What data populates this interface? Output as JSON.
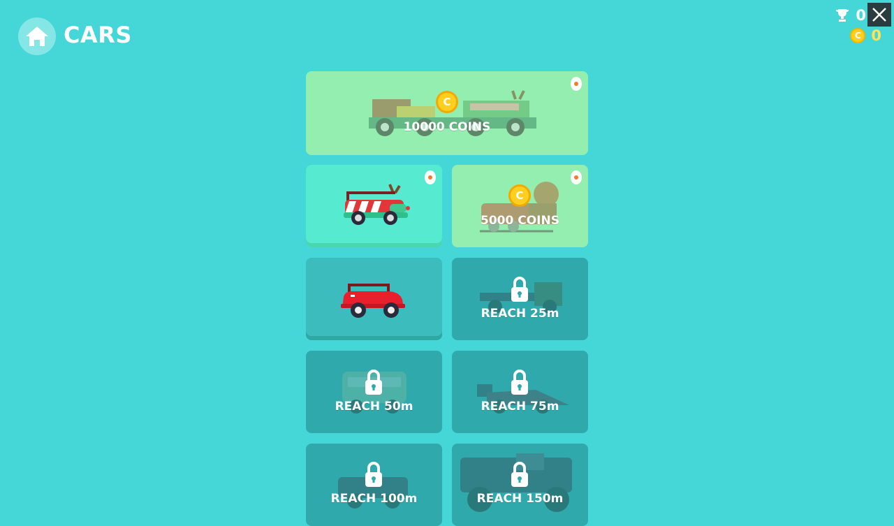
{
  "header": {
    "title": "CARS",
    "trophy_count": "0",
    "coin_count": "0"
  },
  "icons": {
    "home": "home-icon",
    "trophy": "trophy-icon",
    "coin": "coin-icon",
    "close": "close-icon",
    "egg": "egg-icon",
    "lock": "lock-icon"
  },
  "cars": [
    {
      "id": "reindeer-sleigh-limo",
      "state": "for-sale",
      "label": "10000 COINS"
    },
    {
      "id": "reindeer-jeep",
      "state": "selected",
      "label": ""
    },
    {
      "id": "reindeer-sleigh",
      "state": "for-sale",
      "label": "5000 COINS"
    },
    {
      "id": "red-buggy",
      "state": "owned",
      "label": ""
    },
    {
      "id": "truck",
      "state": "locked",
      "label": "REACH 25m"
    },
    {
      "id": "van",
      "state": "locked",
      "label": "REACH 50m"
    },
    {
      "id": "race-car",
      "state": "locked",
      "label": "REACH 75m"
    },
    {
      "id": "jeep",
      "state": "locked",
      "label": "REACH 100m"
    },
    {
      "id": "monster-truck",
      "state": "locked",
      "label": "REACH 150m"
    }
  ],
  "coin_symbol": "C",
  "colors": {
    "background": "#45d6d8",
    "sale": "#94eeaf",
    "selected": "#56ebd1",
    "owned": "#3cbcbc",
    "locked": "#2fa9ab",
    "coin": "#ffcf1f"
  }
}
